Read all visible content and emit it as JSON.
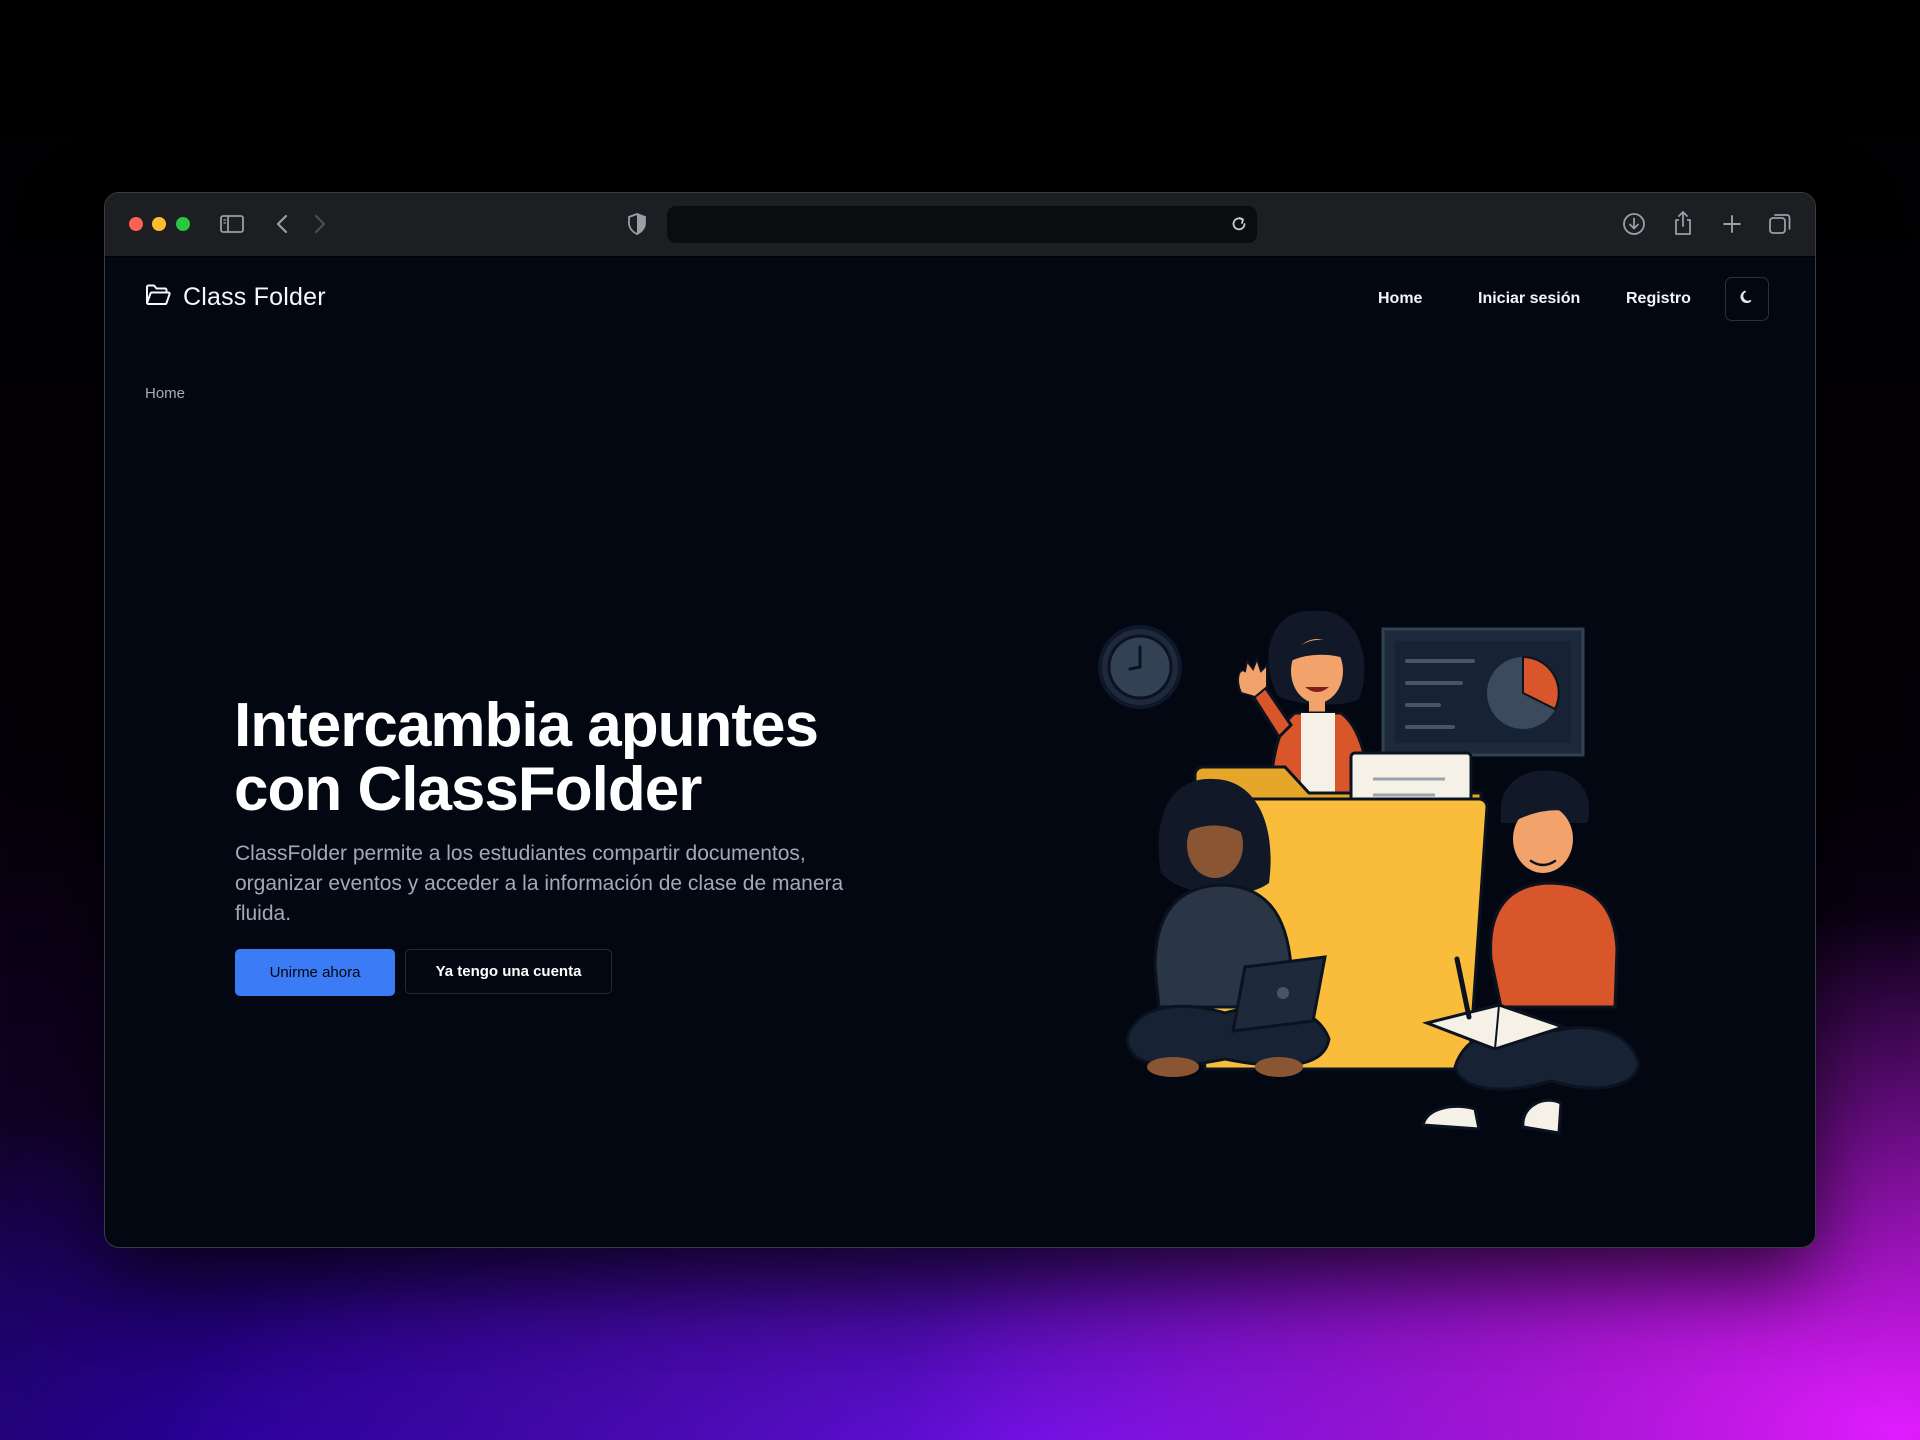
{
  "browser": {
    "url": "",
    "controls": [
      "sidebar-icon",
      "back-icon",
      "forward-icon",
      "shield-icon",
      "reload-icon",
      "download-icon",
      "share-icon",
      "new-tab-icon",
      "tabs-overview-icon"
    ]
  },
  "header": {
    "brand": "Class Folder",
    "brand_icon": "folder-open-icon",
    "nav": {
      "home": "Home",
      "login": "Iniciar sesión",
      "register": "Registro"
    },
    "theme_toggle_icon": "moon-icon"
  },
  "breadcrumb": "Home",
  "hero": {
    "title_line1": "Intercambia apuntes",
    "title_line2": "con ClassFolder",
    "description": "ClassFolder permite a los estudiantes compartir documentos, organizar eventos y acceder a la información de clase de manera fluida.",
    "primary_button": "Unirme ahora",
    "secondary_button": "Ya tengo una cuenta"
  },
  "colors": {
    "primary": "#3b7bf6",
    "page_bg": "#030712",
    "folder": "#f9bd3b",
    "accent_orange": "#d9562a"
  }
}
